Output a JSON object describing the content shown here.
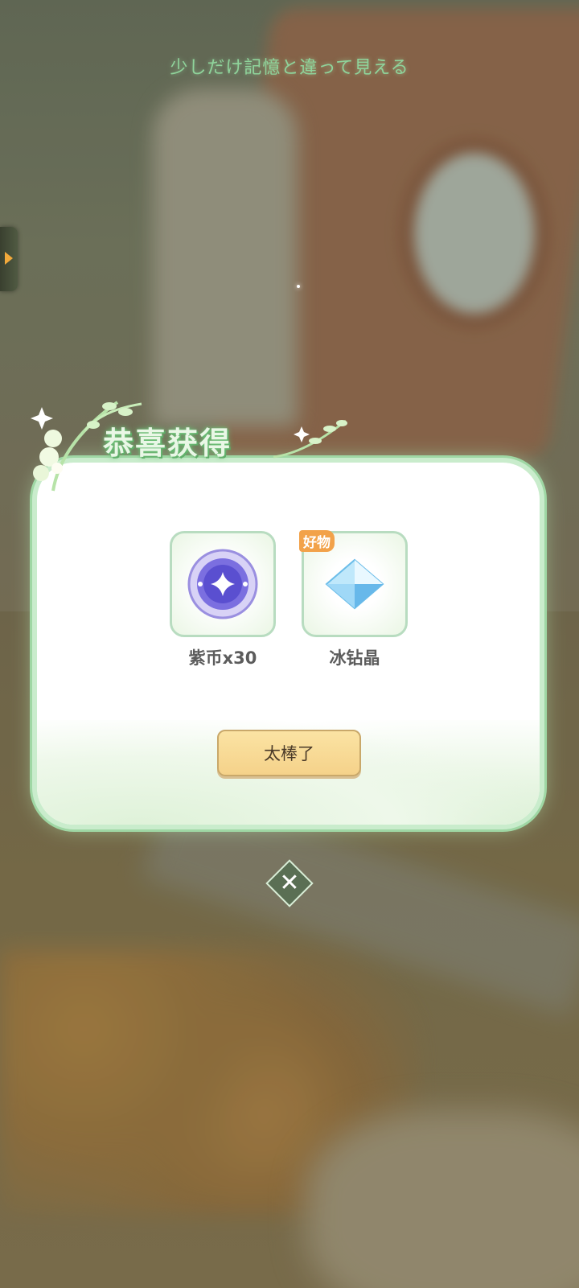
{
  "scene": {
    "caption": "少しだけ記憶と違って見える"
  },
  "dialog": {
    "title": "恭喜获得",
    "items": [
      {
        "label": "紫币x30",
        "icon": "purple-coin-icon"
      },
      {
        "label": "冰钻晶",
        "icon": "ice-crystal-icon",
        "badge": "好物"
      }
    ],
    "confirm_label": "太棒了",
    "close_icon": "close-icon",
    "close_glyph": "✕"
  },
  "colors": {
    "accent_green": "#9fd7a4",
    "button_yellow": "#f5d28a",
    "badge_orange": "#f2a24a"
  }
}
